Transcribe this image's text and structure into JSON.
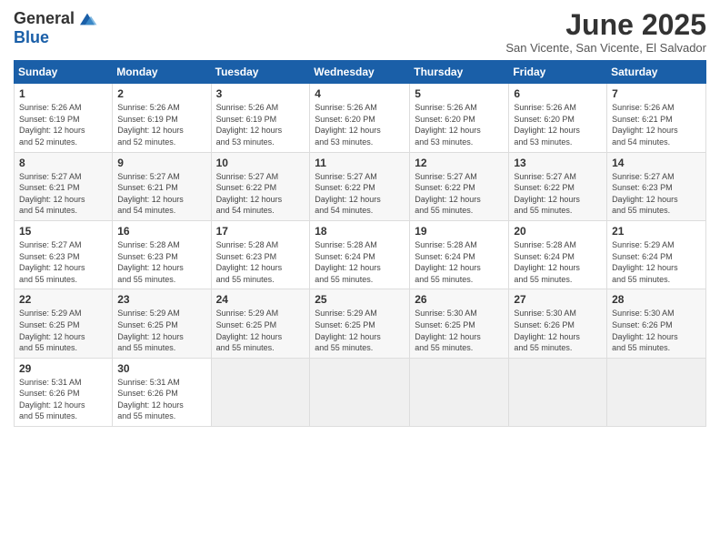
{
  "logo": {
    "general": "General",
    "blue": "Blue"
  },
  "title": {
    "month": "June 2025",
    "location": "San Vicente, San Vicente, El Salvador"
  },
  "headers": [
    "Sunday",
    "Monday",
    "Tuesday",
    "Wednesday",
    "Thursday",
    "Friday",
    "Saturday"
  ],
  "weeks": [
    [
      {
        "num": "1",
        "sunrise": "5:26 AM",
        "sunset": "6:19 PM",
        "daylight": "12 hours and 52 minutes."
      },
      {
        "num": "2",
        "sunrise": "5:26 AM",
        "sunset": "6:19 PM",
        "daylight": "12 hours and 52 minutes."
      },
      {
        "num": "3",
        "sunrise": "5:26 AM",
        "sunset": "6:19 PM",
        "daylight": "12 hours and 53 minutes."
      },
      {
        "num": "4",
        "sunrise": "5:26 AM",
        "sunset": "6:20 PM",
        "daylight": "12 hours and 53 minutes."
      },
      {
        "num": "5",
        "sunrise": "5:26 AM",
        "sunset": "6:20 PM",
        "daylight": "12 hours and 53 minutes."
      },
      {
        "num": "6",
        "sunrise": "5:26 AM",
        "sunset": "6:20 PM",
        "daylight": "12 hours and 53 minutes."
      },
      {
        "num": "7",
        "sunrise": "5:26 AM",
        "sunset": "6:21 PM",
        "daylight": "12 hours and 54 minutes."
      }
    ],
    [
      {
        "num": "8",
        "sunrise": "5:27 AM",
        "sunset": "6:21 PM",
        "daylight": "12 hours and 54 minutes."
      },
      {
        "num": "9",
        "sunrise": "5:27 AM",
        "sunset": "6:21 PM",
        "daylight": "12 hours and 54 minutes."
      },
      {
        "num": "10",
        "sunrise": "5:27 AM",
        "sunset": "6:22 PM",
        "daylight": "12 hours and 54 minutes."
      },
      {
        "num": "11",
        "sunrise": "5:27 AM",
        "sunset": "6:22 PM",
        "daylight": "12 hours and 54 minutes."
      },
      {
        "num": "12",
        "sunrise": "5:27 AM",
        "sunset": "6:22 PM",
        "daylight": "12 hours and 55 minutes."
      },
      {
        "num": "13",
        "sunrise": "5:27 AM",
        "sunset": "6:22 PM",
        "daylight": "12 hours and 55 minutes."
      },
      {
        "num": "14",
        "sunrise": "5:27 AM",
        "sunset": "6:23 PM",
        "daylight": "12 hours and 55 minutes."
      }
    ],
    [
      {
        "num": "15",
        "sunrise": "5:27 AM",
        "sunset": "6:23 PM",
        "daylight": "12 hours and 55 minutes."
      },
      {
        "num": "16",
        "sunrise": "5:28 AM",
        "sunset": "6:23 PM",
        "daylight": "12 hours and 55 minutes."
      },
      {
        "num": "17",
        "sunrise": "5:28 AM",
        "sunset": "6:23 PM",
        "daylight": "12 hours and 55 minutes."
      },
      {
        "num": "18",
        "sunrise": "5:28 AM",
        "sunset": "6:24 PM",
        "daylight": "12 hours and 55 minutes."
      },
      {
        "num": "19",
        "sunrise": "5:28 AM",
        "sunset": "6:24 PM",
        "daylight": "12 hours and 55 minutes."
      },
      {
        "num": "20",
        "sunrise": "5:28 AM",
        "sunset": "6:24 PM",
        "daylight": "12 hours and 55 minutes."
      },
      {
        "num": "21",
        "sunrise": "5:29 AM",
        "sunset": "6:24 PM",
        "daylight": "12 hours and 55 minutes."
      }
    ],
    [
      {
        "num": "22",
        "sunrise": "5:29 AM",
        "sunset": "6:25 PM",
        "daylight": "12 hours and 55 minutes."
      },
      {
        "num": "23",
        "sunrise": "5:29 AM",
        "sunset": "6:25 PM",
        "daylight": "12 hours and 55 minutes."
      },
      {
        "num": "24",
        "sunrise": "5:29 AM",
        "sunset": "6:25 PM",
        "daylight": "12 hours and 55 minutes."
      },
      {
        "num": "25",
        "sunrise": "5:29 AM",
        "sunset": "6:25 PM",
        "daylight": "12 hours and 55 minutes."
      },
      {
        "num": "26",
        "sunrise": "5:30 AM",
        "sunset": "6:25 PM",
        "daylight": "12 hours and 55 minutes."
      },
      {
        "num": "27",
        "sunrise": "5:30 AM",
        "sunset": "6:26 PM",
        "daylight": "12 hours and 55 minutes."
      },
      {
        "num": "28",
        "sunrise": "5:30 AM",
        "sunset": "6:26 PM",
        "daylight": "12 hours and 55 minutes."
      }
    ],
    [
      {
        "num": "29",
        "sunrise": "5:31 AM",
        "sunset": "6:26 PM",
        "daylight": "12 hours and 55 minutes."
      },
      {
        "num": "30",
        "sunrise": "5:31 AM",
        "sunset": "6:26 PM",
        "daylight": "12 hours and 55 minutes."
      },
      null,
      null,
      null,
      null,
      null
    ]
  ],
  "labels": {
    "sunrise": "Sunrise:",
    "sunset": "Sunset:",
    "daylight": "Daylight:"
  }
}
